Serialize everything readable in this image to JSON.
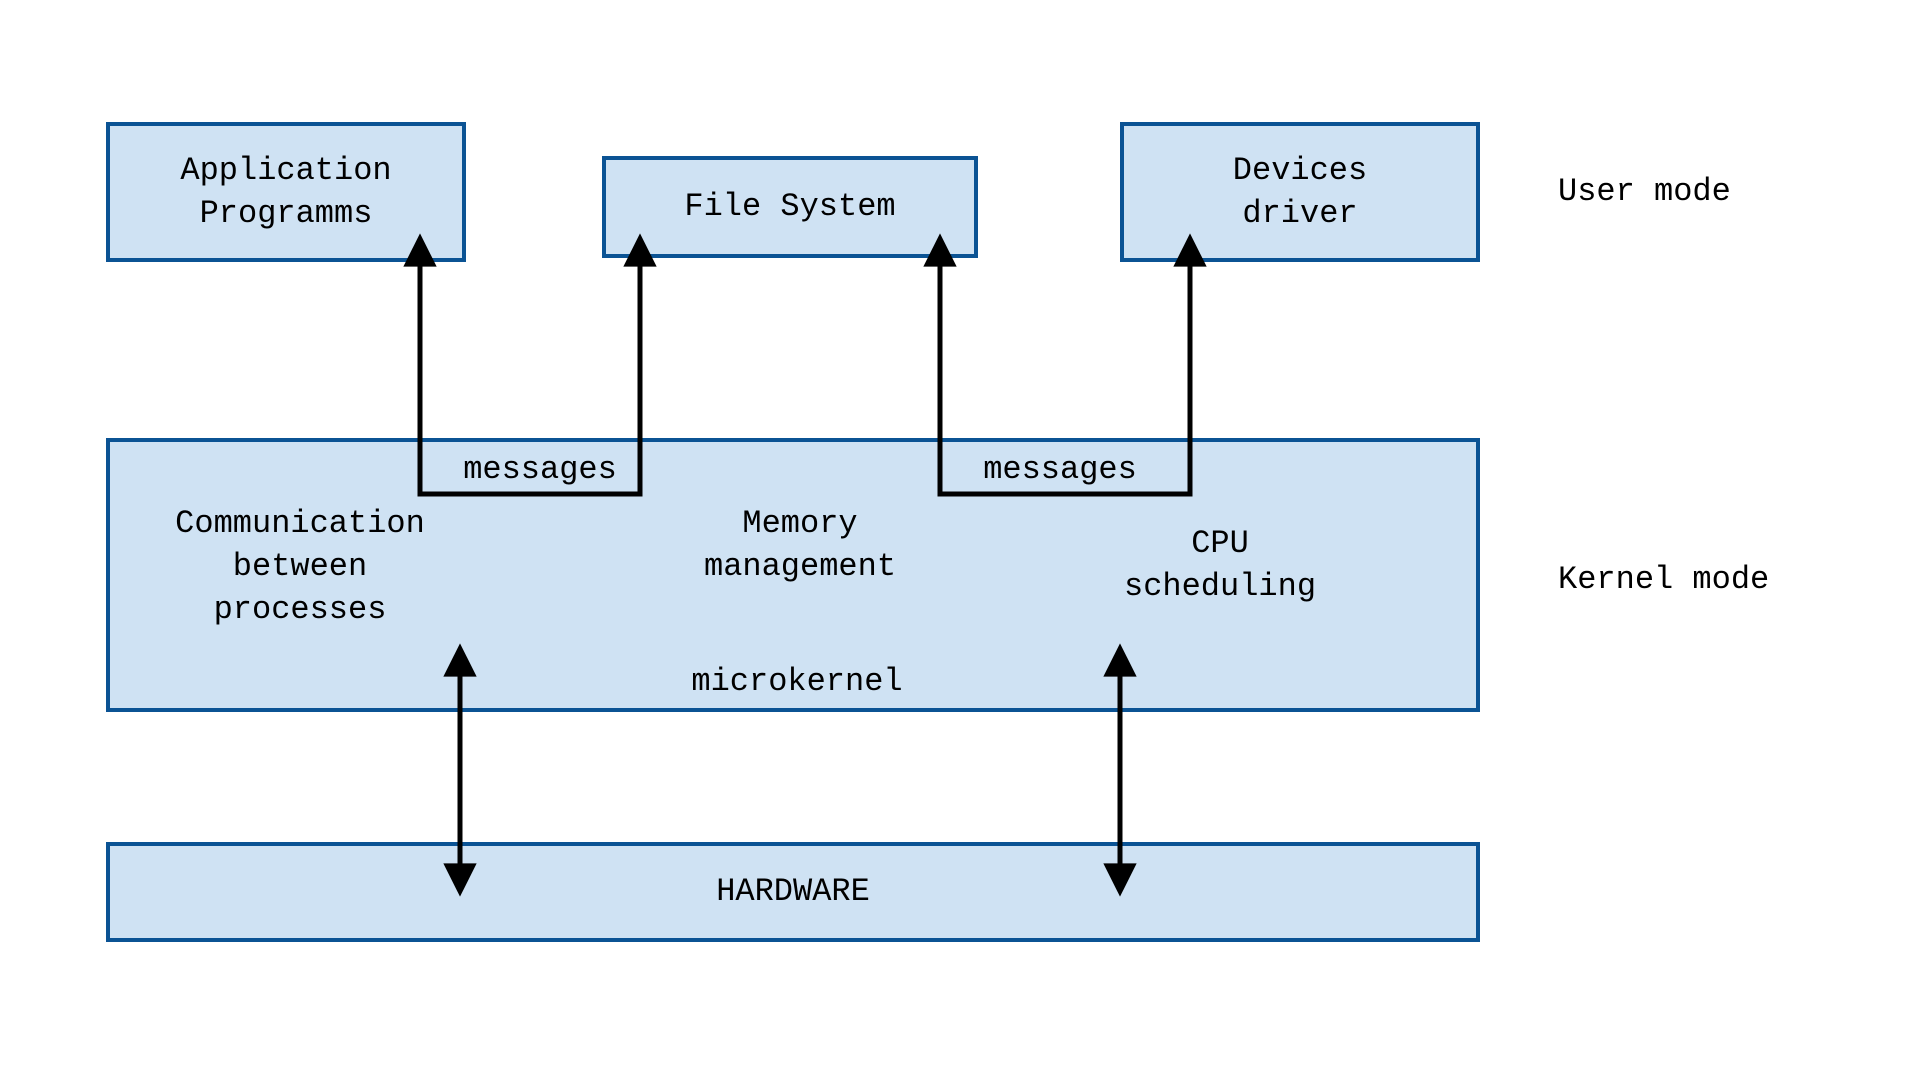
{
  "user_mode_label": "User mode",
  "kernel_mode_label": "Kernel mode",
  "top_boxes": {
    "app": "Application\nProgramms",
    "fs": "File System",
    "dev": "Devices\ndriver"
  },
  "kernel_box": {
    "ipc": "Communication\nbetween\nprocesses",
    "mem": "Memory\nmanagement",
    "cpu": "CPU\nscheduling",
    "caption": "microkernel"
  },
  "hardware": "HARDWARE",
  "msg_left": "messages",
  "msg_right": "messages",
  "colors": {
    "box_fill": "#cfe2f3",
    "box_border": "#0b5394",
    "arrow": "#000000"
  }
}
